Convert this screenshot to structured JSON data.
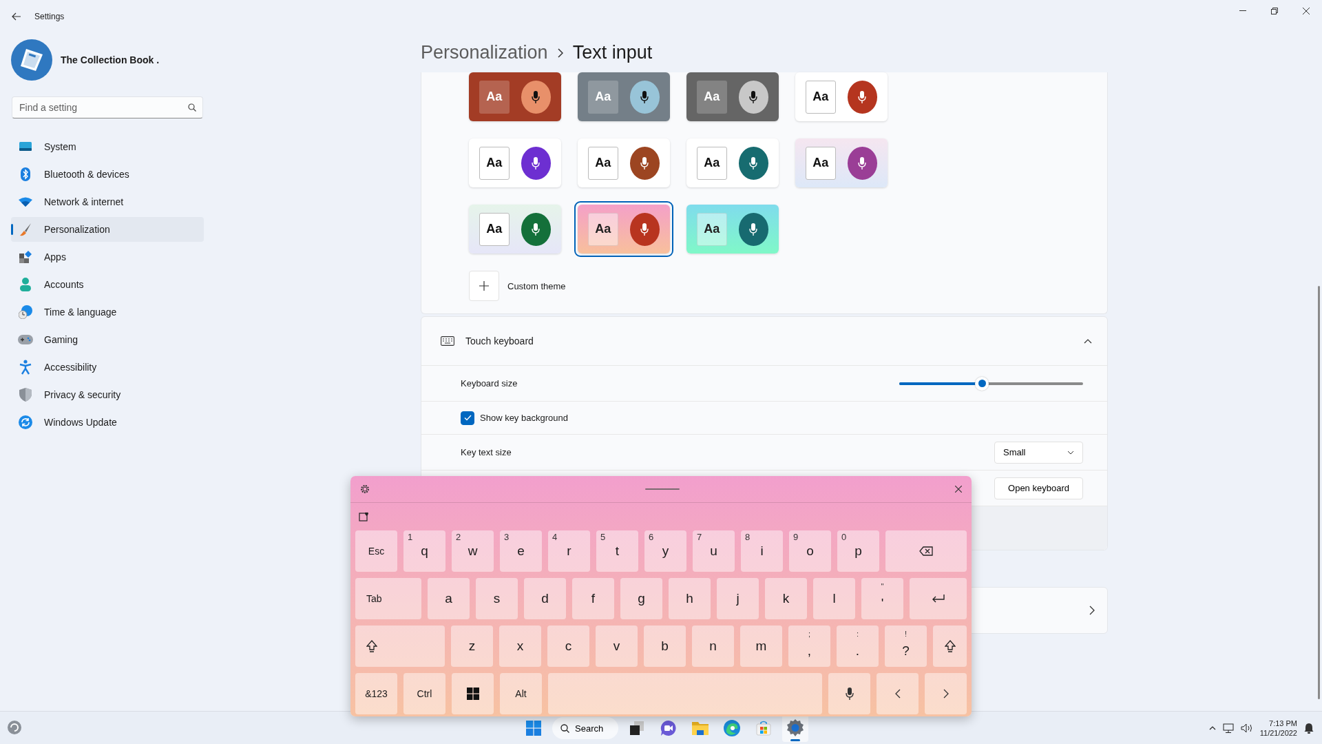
{
  "window": {
    "title": "Settings"
  },
  "profile": {
    "name": "The Collection Book ."
  },
  "search": {
    "placeholder": "Find a setting"
  },
  "nav": [
    {
      "label": "System",
      "selected": false
    },
    {
      "label": "Bluetooth & devices",
      "selected": false
    },
    {
      "label": "Network & internet",
      "selected": false
    },
    {
      "label": "Personalization",
      "selected": true
    },
    {
      "label": "Apps",
      "selected": false
    },
    {
      "label": "Accounts",
      "selected": false
    },
    {
      "label": "Time & language",
      "selected": false
    },
    {
      "label": "Gaming",
      "selected": false
    },
    {
      "label": "Accessibility",
      "selected": false
    },
    {
      "label": "Privacy & security",
      "selected": false
    },
    {
      "label": "Windows Update",
      "selected": false
    }
  ],
  "breadcrumb": [
    {
      "label": "Personalization",
      "current": false
    },
    {
      "label": "Text input",
      "current": true
    }
  ],
  "themes": [
    {
      "label": "Aa",
      "kind": "brick",
      "color": "#e8906a",
      "selected": false
    },
    {
      "label": "Aa",
      "kind": "slate",
      "color": "#98c4d8",
      "selected": false
    },
    {
      "label": "Aa",
      "kind": "graphite",
      "color": "#c8c8c8",
      "selected": false
    },
    {
      "label": "Aa",
      "kind": "white",
      "color": "#b5351f",
      "selected": false
    },
    {
      "label": "Aa",
      "kind": "white",
      "color": "#6d2fd1",
      "selected": false
    },
    {
      "label": "Aa",
      "kind": "white",
      "color": "#9c4521",
      "selected": false
    },
    {
      "label": "Aa",
      "kind": "white",
      "color": "#176c70",
      "selected": false
    },
    {
      "label": "Aa",
      "kind": "lavender",
      "color": "#9a3e96",
      "selected": false
    },
    {
      "label": "Aa",
      "kind": "mint",
      "color": "#14703a",
      "selected": false
    },
    {
      "label": "Aa",
      "kind": "pink",
      "color": "#b8341f",
      "selected": true
    },
    {
      "label": "Aa",
      "kind": "aqua",
      "color": "#176a70",
      "selected": false
    }
  ],
  "custom_theme": {
    "label": "Custom theme"
  },
  "touch_keyboard": {
    "title": "Touch keyboard",
    "expanded": true,
    "keyboard_size": {
      "label": "Keyboard size",
      "level": 0.45
    },
    "show_key_background": {
      "label": "Show key background",
      "checked": true
    },
    "key_text_size": {
      "label": "Key text size",
      "value": "Small"
    },
    "open_keyboard": {
      "button": "Open keyboard"
    }
  },
  "keyboard": {
    "rows": [
      {
        "keys": [
          {
            "kind": "label",
            "label": "Esc"
          },
          {
            "kind": "char",
            "label": "q",
            "hint": "1"
          },
          {
            "kind": "char",
            "label": "w",
            "hint": "2"
          },
          {
            "kind": "char",
            "label": "e",
            "hint": "3"
          },
          {
            "kind": "char",
            "label": "r",
            "hint": "4"
          },
          {
            "kind": "char",
            "label": "t",
            "hint": "5"
          },
          {
            "kind": "char",
            "label": "y",
            "hint": "6"
          },
          {
            "kind": "char",
            "label": "u",
            "hint": "7"
          },
          {
            "kind": "char",
            "label": "i",
            "hint": "8"
          },
          {
            "kind": "char",
            "label": "o",
            "hint": "9"
          },
          {
            "kind": "char",
            "label": "p",
            "hint": "0"
          },
          {
            "kind": "backspace"
          }
        ]
      },
      {
        "keys": [
          {
            "kind": "tab",
            "label": "Tab"
          },
          {
            "kind": "char",
            "label": "a"
          },
          {
            "kind": "char",
            "label": "s"
          },
          {
            "kind": "char",
            "label": "d"
          },
          {
            "kind": "char",
            "label": "f"
          },
          {
            "kind": "char",
            "label": "g"
          },
          {
            "kind": "char",
            "label": "h"
          },
          {
            "kind": "char",
            "label": "j"
          },
          {
            "kind": "char",
            "label": "k"
          },
          {
            "kind": "char",
            "label": "l"
          },
          {
            "kind": "punct",
            "label": "'",
            "hint": "\""
          },
          {
            "kind": "enter"
          }
        ]
      },
      {
        "keys": [
          {
            "kind": "shift"
          },
          {
            "kind": "char",
            "label": "z"
          },
          {
            "kind": "char",
            "label": "x"
          },
          {
            "kind": "char",
            "label": "c"
          },
          {
            "kind": "char",
            "label": "v"
          },
          {
            "kind": "char",
            "label": "b"
          },
          {
            "kind": "char",
            "label": "n"
          },
          {
            "kind": "char",
            "label": "m"
          },
          {
            "kind": "punct",
            "label": ",",
            "hint": ";"
          },
          {
            "kind": "punct",
            "label": ".",
            "hint": ":"
          },
          {
            "kind": "punct",
            "label": "?",
            "hint": "!"
          },
          {
            "kind": "shift"
          }
        ]
      },
      {
        "keys": [
          {
            "kind": "label",
            "label": "&123"
          },
          {
            "kind": "label",
            "label": "Ctrl"
          },
          {
            "kind": "windows"
          },
          {
            "kind": "label",
            "label": "Alt"
          },
          {
            "kind": "space"
          },
          {
            "kind": "mic"
          },
          {
            "kind": "left"
          },
          {
            "kind": "right"
          }
        ]
      }
    ]
  },
  "taskbar": {
    "search": "Search",
    "apps": [
      {
        "selected": false
      },
      {
        "selected": false
      },
      {
        "selected": false
      },
      {
        "selected": false
      },
      {
        "selected": false
      },
      {
        "selected": true
      }
    ],
    "time": "7:13 PM",
    "date": "11/21/2022"
  }
}
